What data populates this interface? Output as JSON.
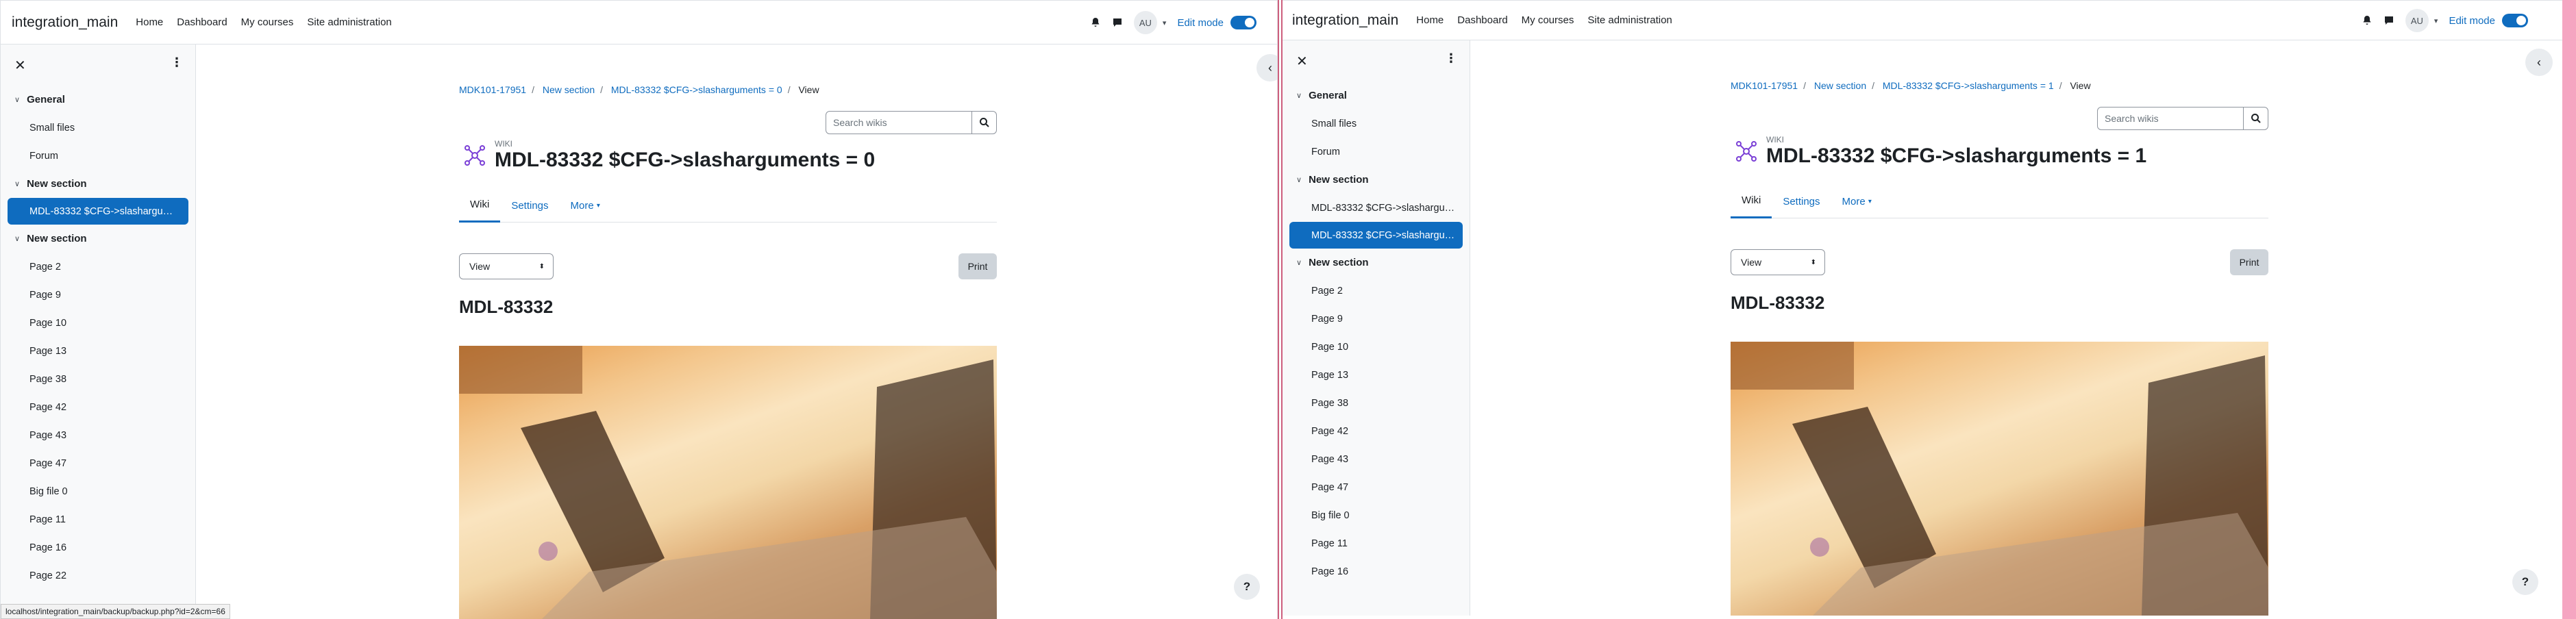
{
  "windows": [
    {
      "navbar": {
        "brand": "integration_main",
        "links": [
          "Home",
          "Dashboard",
          "My courses",
          "Site administration"
        ],
        "avatar": "AU",
        "edit_mode": "Edit mode"
      },
      "drawer": {
        "sections": [
          {
            "title": "General",
            "items": [
              {
                "label": "Small files"
              },
              {
                "label": "Forum"
              }
            ]
          },
          {
            "title": "New section",
            "items": [
              {
                "label": "MDL-83332 $CFG->slasharguments = 0",
                "display": "MDL-83332 $CFG->slashargu…",
                "active": true
              }
            ]
          },
          {
            "title": "New section",
            "items": [
              {
                "label": "Page 2"
              },
              {
                "label": "Page 9"
              },
              {
                "label": "Page 10"
              },
              {
                "label": "Page 13"
              },
              {
                "label": "Page 38"
              },
              {
                "label": "Page 42"
              },
              {
                "label": "Page 43"
              },
              {
                "label": "Page 47"
              },
              {
                "label": "Big file 0"
              },
              {
                "label": "Page 11"
              },
              {
                "label": "Page 16"
              },
              {
                "label": "Page 22"
              }
            ]
          }
        ]
      },
      "breadcrumb": [
        "MDK101-17951",
        "New section",
        "MDL-83332 $CFG->slasharguments = 0",
        "View"
      ],
      "search_placeholder": "Search wikis",
      "module_label": "WIKI",
      "page_title": "MDL-83332 $CFG->slasharguments = 0",
      "tabs": [
        "Wiki",
        "Settings",
        "More"
      ],
      "select_value": "View",
      "print_label": "Print",
      "page_heading": "MDL-83332",
      "help_label": "?",
      "status_url": "localhost/integration_main/backup/backup.php?id=2&cm=66"
    },
    {
      "navbar": {
        "brand": "integration_main",
        "links": [
          "Home",
          "Dashboard",
          "My courses",
          "Site administration"
        ],
        "avatar": "AU",
        "edit_mode": "Edit mode"
      },
      "drawer": {
        "sections": [
          {
            "title": "General",
            "items": [
              {
                "label": "Small files"
              },
              {
                "label": "Forum"
              }
            ]
          },
          {
            "title": "New section",
            "items": [
              {
                "label": "MDL-83332 $CFG->slasharguments = 0",
                "display": "MDL-83332 $CFG->slashargu…"
              },
              {
                "label": "MDL-83332 $CFG->slasharguments = 1",
                "display": "MDL-83332 $CFG->slashargu…",
                "active": true
              }
            ]
          },
          {
            "title": "New section",
            "items": [
              {
                "label": "Page 2"
              },
              {
                "label": "Page 9"
              },
              {
                "label": "Page 10"
              },
              {
                "label": "Page 13"
              },
              {
                "label": "Page 38"
              },
              {
                "label": "Page 42"
              },
              {
                "label": "Page 43"
              },
              {
                "label": "Page 47"
              },
              {
                "label": "Big file 0"
              },
              {
                "label": "Page 11"
              },
              {
                "label": "Page 16"
              }
            ]
          }
        ]
      },
      "breadcrumb": [
        "MDK101-17951",
        "New section",
        "MDL-83332 $CFG->slasharguments = 1",
        "View"
      ],
      "search_placeholder": "Search wikis",
      "module_label": "WIKI",
      "page_title": "MDL-83332 $CFG->slasharguments = 1",
      "tabs": [
        "Wiki",
        "Settings",
        "More"
      ],
      "select_value": "View",
      "print_label": "Print",
      "page_heading": "MDL-83332",
      "help_label": "?"
    }
  ],
  "colors": {
    "primary": "#0f6cbf",
    "drawer_bg": "#f8f9fa",
    "split_divider": "#cd5e7d"
  },
  "icons": [
    "close-icon",
    "kebab-icon",
    "bell-icon",
    "chat-icon",
    "search-icon",
    "wiki-icon",
    "chevron-left-icon",
    "help-icon"
  ]
}
